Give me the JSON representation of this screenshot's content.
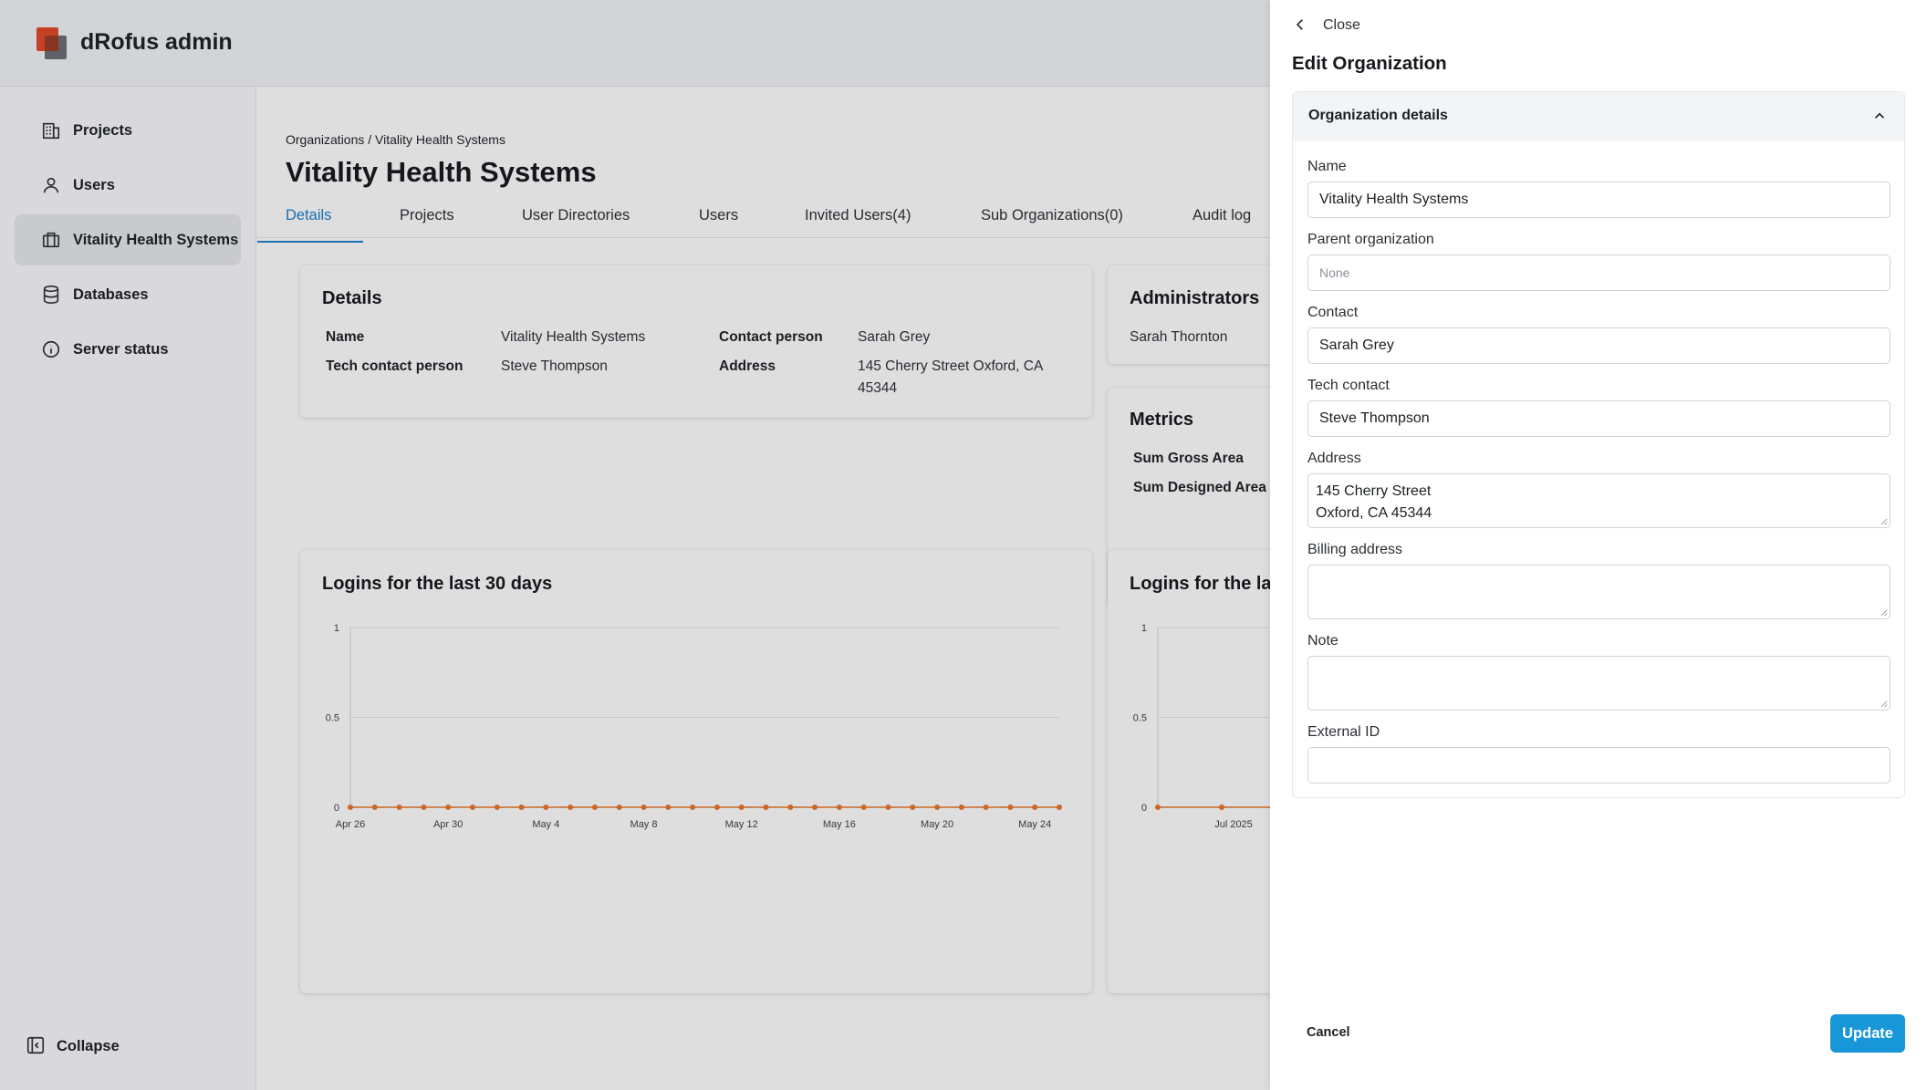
{
  "app": {
    "title": "dRofus admin"
  },
  "sidebar": {
    "items": [
      {
        "label": "Projects",
        "icon": "building-icon"
      },
      {
        "label": "Users",
        "icon": "user-icon"
      },
      {
        "label": "Vitality Health Systems",
        "icon": "briefcase-icon",
        "active": true
      },
      {
        "label": "Databases",
        "icon": "database-icon"
      },
      {
        "label": "Server status",
        "icon": "info-icon"
      }
    ],
    "collapse_label": "Collapse"
  },
  "main": {
    "breadcrumb": "Organizations / Vitality Health Systems",
    "title": "Vitality Health Systems",
    "tabs": [
      {
        "label": "Details",
        "active": true
      },
      {
        "label": "Projects"
      },
      {
        "label": "User Directories"
      },
      {
        "label": "Users"
      },
      {
        "label": "Invited Users(4)"
      },
      {
        "label": "Sub Organizations(0)"
      },
      {
        "label": "Audit log"
      }
    ],
    "details": {
      "heading": "Details",
      "name_label": "Name",
      "name_value": "Vitality Health Systems",
      "contact_label": "Contact person",
      "contact_value": "Sarah Grey",
      "tech_label": "Tech contact person",
      "tech_value": "Steve Thompson",
      "address_label": "Address",
      "address_value": "145 Cherry Street Oxford, CA 45344"
    },
    "administrators": {
      "heading": "Administrators",
      "names": [
        "Sarah Thornton"
      ]
    },
    "metrics": {
      "heading": "Metrics",
      "gross_label": "Sum Gross Area",
      "designed_label": "Sum Designed Area"
    },
    "charts": [
      {
        "heading": "Logins for the last 30 days"
      },
      {
        "heading": "Logins for the la"
      }
    ]
  },
  "chart_data": [
    {
      "type": "line",
      "title": "Logins for the last 30 days",
      "x": [
        "Apr 26",
        "Apr 27",
        "Apr 28",
        "Apr 29",
        "Apr 30",
        "May 1",
        "May 2",
        "May 3",
        "May 4",
        "May 5",
        "May 6",
        "May 7",
        "May 8",
        "May 9",
        "May 10",
        "May 11",
        "May 12",
        "May 13",
        "May 14",
        "May 15",
        "May 16",
        "May 17",
        "May 18",
        "May 19",
        "May 20",
        "May 21",
        "May 22",
        "May 23",
        "May 24",
        "May 25"
      ],
      "x_tick_labels": [
        "Apr 26",
        "Apr 30",
        "May 4",
        "May 8",
        "May 12",
        "May 16",
        "May 20",
        "May 24"
      ],
      "y": [
        0,
        0,
        0,
        0,
        0,
        0,
        0,
        0,
        0,
        0,
        0,
        0,
        0,
        0,
        0,
        0,
        0,
        0,
        0,
        0,
        0,
        0,
        0,
        0,
        0,
        0,
        0,
        0,
        0,
        0
      ],
      "y_tick_labels": [
        "1",
        "0.5",
        "0"
      ],
      "ylim": [
        0,
        1
      ],
      "grid": true,
      "series_color": "#e8762b"
    },
    {
      "type": "line",
      "title": "Logins for the la",
      "x_tick_labels": [
        "Jul 2025"
      ],
      "y_tick_labels": [
        "1",
        "0.5",
        "0"
      ],
      "ylim": [
        0,
        1
      ],
      "grid": true,
      "series_color": "#e8762b"
    }
  ],
  "drawer": {
    "close_label": "Close",
    "title": "Edit Organization",
    "section_title": "Organization details",
    "fields": {
      "name": {
        "label": "Name",
        "value": "Vitality Health Systems"
      },
      "parent": {
        "label": "Parent organization",
        "placeholder": "None"
      },
      "contact": {
        "label": "Contact",
        "value": "Sarah Grey"
      },
      "tech": {
        "label": "Tech contact",
        "value": "Steve Thompson"
      },
      "address": {
        "label": "Address",
        "line1": "145 Cherry Street",
        "line2": "Oxford, CA 45344"
      },
      "billing": {
        "label": "Billing address",
        "value": ""
      },
      "note": {
        "label": "Note",
        "value": ""
      },
      "external_id": {
        "label": "External ID",
        "value": ""
      }
    },
    "cancel_label": "Cancel",
    "update_label": "Update"
  },
  "colors": {
    "accent": "#1b7fc4",
    "button": "#1796d8",
    "brand_red": "#e04a28",
    "series": "#e8762b"
  }
}
